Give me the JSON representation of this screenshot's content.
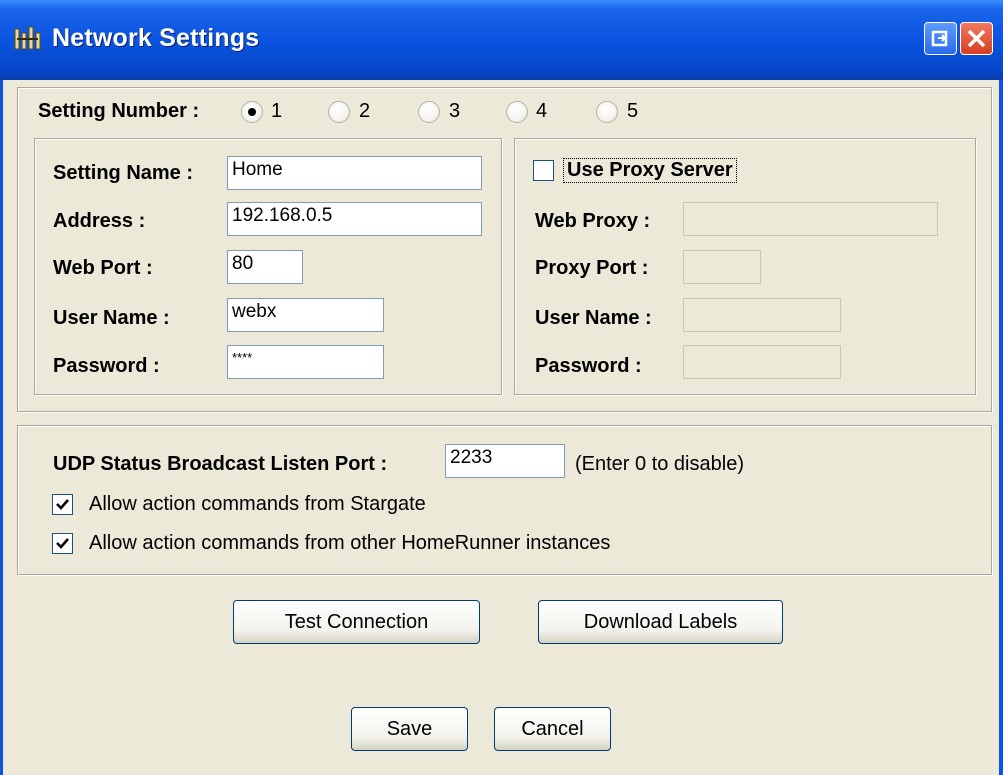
{
  "window": {
    "title": "Network Settings",
    "icon": "network-settings-icon",
    "colors": {
      "titlebar": "#0A54E0",
      "face": "#ECE9D8",
      "close": "#E0542E"
    }
  },
  "setting_number": {
    "label": "Setting Number :",
    "options": [
      "1",
      "2",
      "3",
      "4",
      "5"
    ],
    "selected": "1"
  },
  "connection": {
    "setting_name_label": "Setting Name :",
    "setting_name_value": "Home",
    "address_label": "Address :",
    "address_value": "192.168.0.5",
    "web_port_label": "Web Port :",
    "web_port_value": "80",
    "user_name_label": "User Name :",
    "user_name_value": "webx",
    "password_label": "Password :",
    "password_value": "****"
  },
  "proxy": {
    "use_proxy_label": "Use Proxy Server",
    "use_proxy_checked": false,
    "web_proxy_label": "Web Proxy :",
    "web_proxy_value": "",
    "proxy_port_label": "Proxy Port :",
    "proxy_port_value": "",
    "user_name_label": "User Name :",
    "user_name_value": "",
    "password_label": "Password :",
    "password_value": ""
  },
  "udp": {
    "label": "UDP Status Broadcast Listen Port :",
    "value": "2233",
    "hint": "(Enter 0 to disable)",
    "allow_stargate_label": "Allow action commands from Stargate",
    "allow_stargate_checked": true,
    "allow_homerunner_label": "Allow action commands from other HomeRunner instances",
    "allow_homerunner_checked": true
  },
  "buttons": {
    "test_connection": "Test Connection",
    "download_labels": "Download Labels",
    "save": "Save",
    "cancel": "Cancel"
  }
}
